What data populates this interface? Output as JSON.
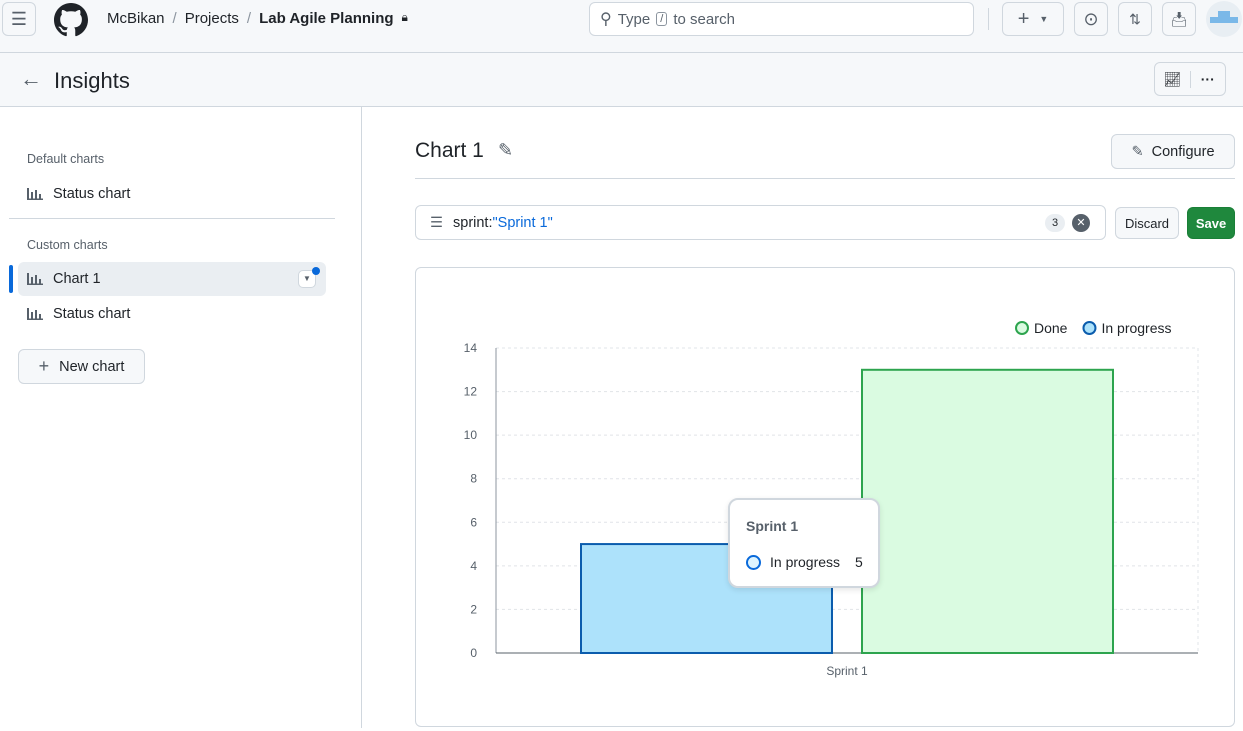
{
  "header": {
    "breadcrumb": [
      "McBikan",
      "Projects",
      "Lab Agile Planning"
    ],
    "search_placeholder_pre": "Type",
    "search_key": "/",
    "search_placeholder_post": "to search"
  },
  "subheader": {
    "title": "Insights"
  },
  "sidebar": {
    "default_heading": "Default charts",
    "default_items": [
      {
        "label": "Status chart"
      }
    ],
    "custom_heading": "Custom charts",
    "custom_items": [
      {
        "label": "Chart 1",
        "active": true
      },
      {
        "label": "Status chart"
      }
    ],
    "new_chart": "New chart"
  },
  "main": {
    "title": "Chart 1",
    "configure": "Configure",
    "filter_key": "sprint:",
    "filter_value": "\"Sprint 1\"",
    "filter_count": "3",
    "discard": "Discard",
    "save": "Save"
  },
  "tooltip": {
    "title": "Sprint 1",
    "series": "In progress",
    "value": "5"
  },
  "colors": {
    "done": "#2da44e",
    "in_progress": "#0969da",
    "save": "#1f883d"
  },
  "chart_data": {
    "type": "bar",
    "categories": [
      "Sprint 1"
    ],
    "series": [
      {
        "name": "In progress",
        "values": [
          5
        ],
        "fill": "#ade2fb",
        "stroke": "#0b5cad"
      },
      {
        "name": "Done",
        "values": [
          13
        ],
        "fill": "#dafbe1",
        "stroke": "#2da44e"
      }
    ],
    "ylim": [
      0,
      14
    ],
    "yticks": [
      0,
      2,
      4,
      6,
      8,
      10,
      12,
      14
    ],
    "grid": true,
    "legend": "top-right",
    "legend_order": [
      "Done",
      "In progress"
    ]
  }
}
